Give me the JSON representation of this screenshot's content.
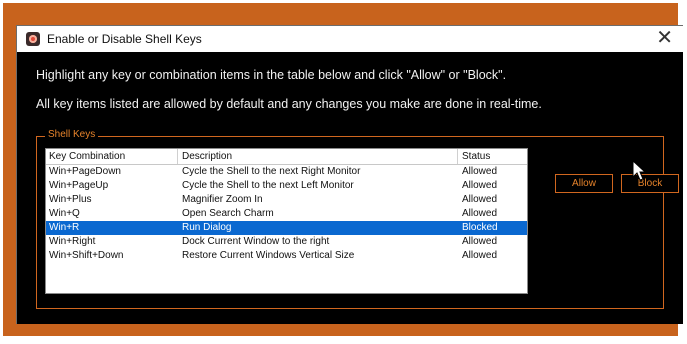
{
  "window": {
    "title": "Enable or Disable Shell Keys",
    "close_glyph": "✕"
  },
  "instructions": {
    "line1": "Highlight any key or combination items in the table below and click \"Allow\" or \"Block\".",
    "line2": "All key items listed are allowed by default and any changes you make are done in real-time."
  },
  "group": {
    "label": "Shell Keys"
  },
  "table": {
    "headers": [
      "Key Combination",
      "Description",
      "Status"
    ],
    "rows": [
      {
        "key": "Win+PageDown",
        "description": "Cycle the Shell to the next Right Monitor",
        "status": "Allowed"
      },
      {
        "key": "Win+PageUp",
        "description": "Cycle the Shell to the next Left Monitor",
        "status": "Allowed"
      },
      {
        "key": "Win+Plus",
        "description": "Magnifier Zoom In",
        "status": "Allowed"
      },
      {
        "key": "Win+Q",
        "description": "Open Search Charm",
        "status": "Allowed"
      },
      {
        "key": "Win+R",
        "description": "Run Dialog",
        "status": "Blocked"
      },
      {
        "key": "Win+Right",
        "description": "Dock Current Window to the right",
        "status": "Allowed"
      },
      {
        "key": "Win+Shift+Down",
        "description": "Restore Current Windows Vertical Size",
        "status": "Allowed"
      }
    ],
    "selected_index": 4
  },
  "buttons": {
    "allow": "Allow",
    "block": "Block"
  },
  "icons": {
    "app": "app-icon",
    "close": "close-icon",
    "cursor": "mouse-pointer-icon"
  },
  "colors": {
    "accent": "#d1671f",
    "selection": "#0a68d0",
    "frame": "#c8631d"
  }
}
